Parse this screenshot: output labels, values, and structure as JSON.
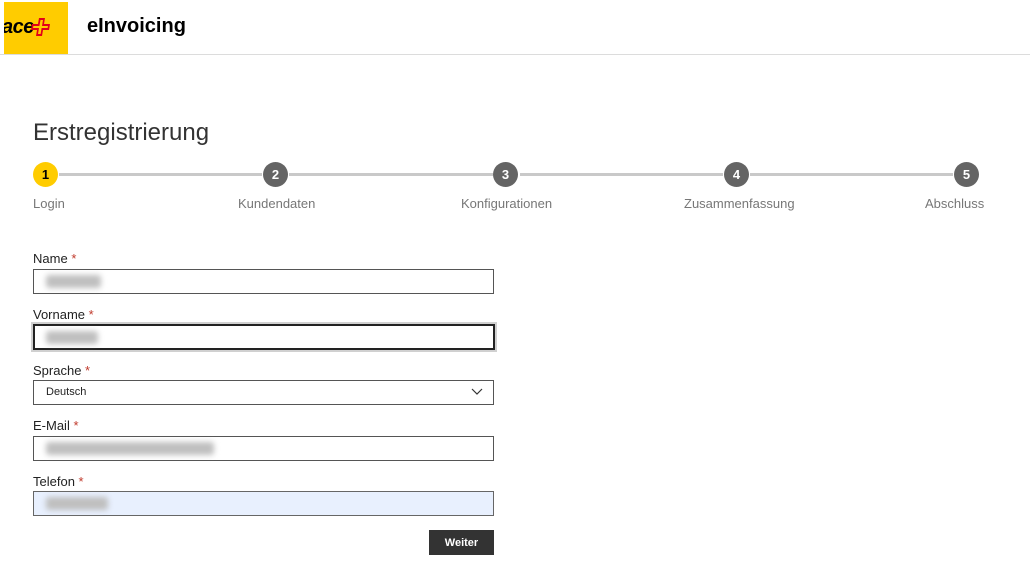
{
  "header": {
    "logo_text": "ace",
    "app_title": "eInvoicing"
  },
  "page": {
    "title": "Erstregistrierung"
  },
  "stepper": {
    "steps": [
      {
        "number": "1",
        "label": "Login"
      },
      {
        "number": "2",
        "label": "Kundendaten"
      },
      {
        "number": "3",
        "label": "Konfigurationen"
      },
      {
        "number": "4",
        "label": "Zusammenfassung"
      },
      {
        "number": "5",
        "label": "Abschluss"
      }
    ],
    "active_step": 1
  },
  "form": {
    "required_marker": "*",
    "name_label": "Name",
    "vorname_label": "Vorname",
    "sprache_label": "Sprache",
    "sprache_value": "Deutsch",
    "email_label": "E-Mail",
    "telefon_label": "Telefon",
    "submit_label": "Weiter"
  },
  "colors": {
    "brand_yellow": "#ffcc00",
    "brand_red": "#e2001a",
    "step_inactive": "#646464",
    "button_dark": "#333333"
  }
}
